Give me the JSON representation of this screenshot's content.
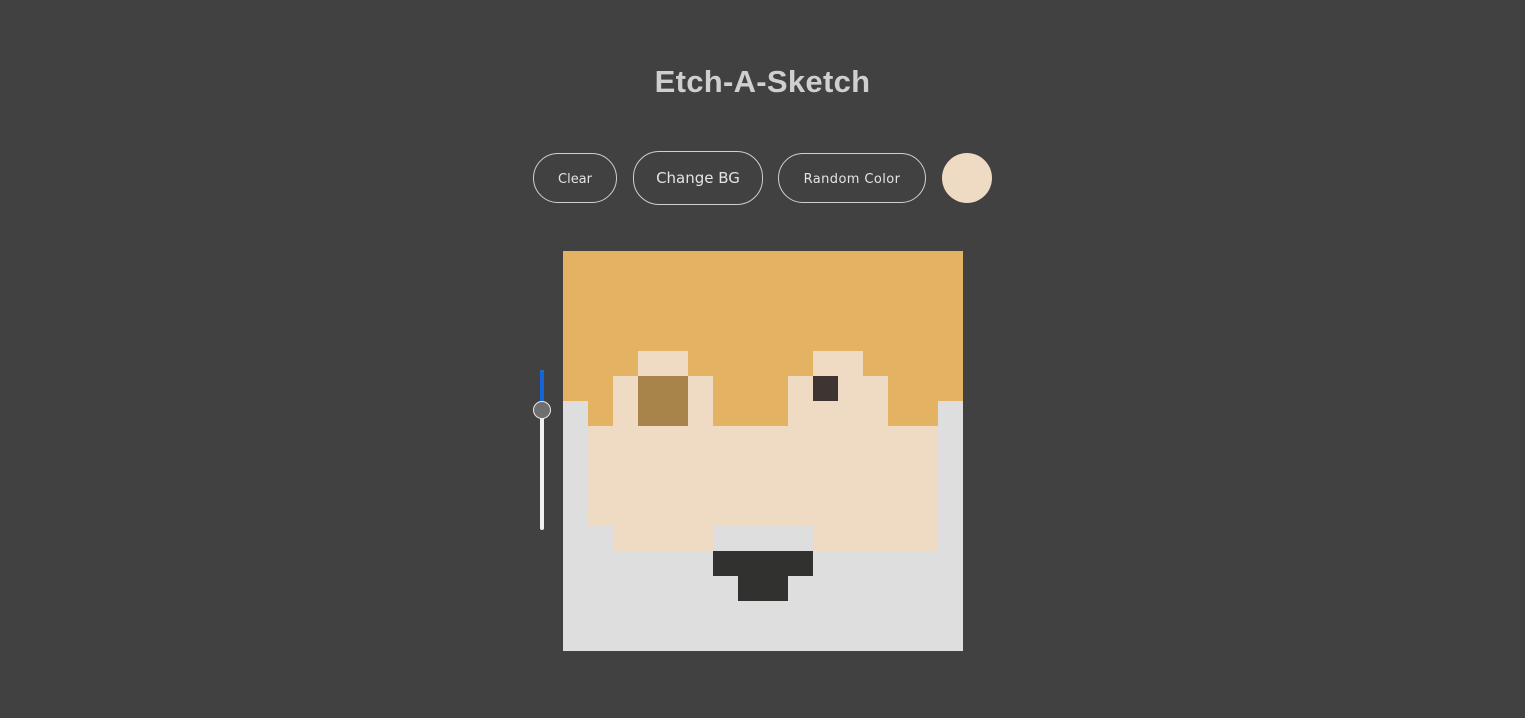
{
  "header": {
    "title": "Etch-A-Sketch"
  },
  "controls": {
    "clear_label": "Clear",
    "change_bg_label": "Change BG",
    "random_color_label": "Random Color",
    "current_color": "#efdac3"
  },
  "grid_size_slider": {
    "value_fraction": 0.25,
    "track_color": "#f0f0f0",
    "fill_color": "#1565d8"
  },
  "canvas": {
    "grid_size": 16,
    "palette": {
      "H": "#e3b262",
      "S": "#efdac3",
      "B": "#a8834a",
      "D": "#3e3432",
      "M": "#313130",
      "W": "#dedede"
    },
    "rows": [
      "HHHHHHHHHHHHHHHH",
      "HHHHHHHHHHHHHHHH",
      "HHHHHHHHHHHHHHHH",
      "HHHHHHHHHHHHHHHH",
      "HHHSSHHHHHSSHHHH",
      "HHSBBSHHHSDSSHHH",
      "WHSBBSHHHSSSSHHW",
      "WSSSSSSSSSSSSSSW",
      "WSSSSSSSSSSSSSSW",
      "WSSSSSSSSSSSSSSW",
      "WSSSSSSSSSSSSSSW",
      "WWSSSSWWWWSSSSSW",
      "WWWWWWMMMMWWWWWW",
      "WWWWWWWMMWWWWWWW",
      "WWWWWWWWWWWWWWWW",
      "WWWWWWWWWWWWWWWW"
    ]
  }
}
